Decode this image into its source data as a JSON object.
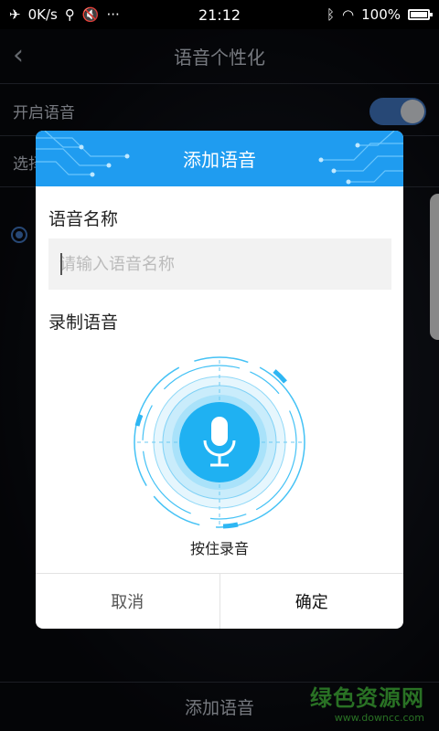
{
  "status_bar": {
    "net_speed": "0K/s",
    "time": "21:12",
    "battery": "100%",
    "icons": [
      "airplane-icon",
      "usb-icon",
      "mute-icon",
      "wifi-icon"
    ]
  },
  "background_page": {
    "title": "语音个性化",
    "rows": [
      {
        "label": "开启语音",
        "has_toggle": true
      },
      {
        "label": "选择语音"
      }
    ],
    "bottom_button": "添加语音",
    "watermark_main": "绿色资源网",
    "watermark_sub": "www.downcc.com"
  },
  "dialog": {
    "title": "添加语音",
    "name_label": "语音名称",
    "name_placeholder": "请输入语音名称",
    "name_value": "",
    "record_label": "录制语音",
    "hold_hint": "按住录音",
    "cancel_label": "取消",
    "confirm_label": "确定"
  },
  "colors": {
    "accent": "#1f9cf0",
    "mic_blue": "#1fb1f2",
    "toggle_blue": "#3c6fb5",
    "watermark_green": "#3fae38"
  }
}
